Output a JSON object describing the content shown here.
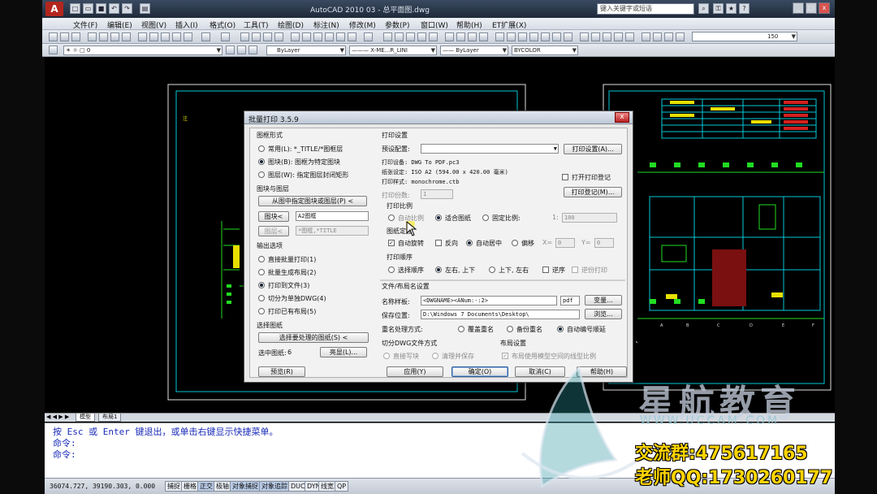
{
  "titlebar": {
    "app_logo": "A",
    "title": "AutoCAD 2010    03 - 总平面图.dwg",
    "search_placeholder": "键入关键字或短语"
  },
  "menu": [
    "文件(F)",
    "编辑(E)",
    "视图(V)",
    "插入(I)",
    "格式(O)",
    "工具(T)",
    "绘图(D)",
    "标注(N)",
    "修改(M)",
    "参数(P)",
    "窗口(W)",
    "帮助(H)",
    "ET扩展(X)"
  ],
  "toolbar": {
    "scale_value": "150",
    "layer_value": "0",
    "color_value": "ByLayer",
    "linetype_value": "X-ME...R_LINI",
    "lineweight_value": "ByLayer",
    "plotstyle_value": "BYCOLOR"
  },
  "tabs": {
    "model": "模型",
    "layout1": "布局1"
  },
  "command": {
    "line1": "按 Esc 或 Enter 键退出，或单击右键显示快捷菜单。",
    "line2": "命令:",
    "line3": "命令:"
  },
  "status": {
    "coords": "36074.727, 39190.303, 0.000",
    "buttons": [
      "捕捉",
      "栅格",
      "正交",
      "极轴",
      "对象捕捉",
      "对象追踪",
      "DUCS",
      "DYN",
      "线宽",
      "QP"
    ],
    "active": [
      2,
      4,
      5
    ]
  },
  "dialog": {
    "title": "批量打印 3.5.9",
    "close": "x",
    "frame": {
      "heading": "图框形式",
      "opt1": "常用(L): *_TITLE/*图框层",
      "opt2": "图块(B): 图框为特定图块",
      "opt3": "图层(W): 指定图层封闭矩形"
    },
    "block_layer": {
      "heading": "图块与图层",
      "pick_button": "从图中指定图块或图层(P) <",
      "block_button": "图块<",
      "block_value": "A2图框",
      "layer_button": "图层<",
      "layer_value": "*图框,*TITLE"
    },
    "output": {
      "heading": "输出选项",
      "opt1": "直接批量打印(1)",
      "opt2": "批量生成布局(2)",
      "opt3": "打印到文件(3)",
      "opt4": "切分为单独DWG(4)",
      "opt5": "打印已有布局(5)"
    },
    "select": {
      "heading": "选择图纸",
      "button": "选择要处理的图纸(S) <",
      "selected_label": "选中图纸:",
      "selected_count": "6",
      "highlight_button": "亮显(L)..."
    },
    "preview_button": "预览(R)",
    "print_settings": {
      "heading": "打印设置",
      "preset_label": "预设配置:",
      "preset_value": "",
      "setup_button": "打印设置(A)...",
      "device": "打印设备: DWG To PDF.pc3",
      "paper": "纸张设定: ISO A2 (594.00 x 420.00 毫米)",
      "style": "打印样式: monochrome.ctb",
      "open_log_label": "打开打印登记",
      "log_button": "打印登记(M)...",
      "copies_label": "打印份数:",
      "copies_value": "1"
    },
    "scale": {
      "heading": "打印比例",
      "auto": "自动比例",
      "fit": "适合图纸",
      "fixed": "固定比例:",
      "ratio_sep": "1:",
      "ratio_value": "100"
    },
    "placement": {
      "heading": "图纸定位",
      "auto_rotate": "自动旋转",
      "reverse": "反向",
      "auto_center": "自动居中",
      "offset": "偏移",
      "x_label": "X=",
      "x_value": "0",
      "y_label": "Y=",
      "y_value": "0"
    },
    "order": {
      "heading": "打印顺序",
      "by_select": "选择顺序",
      "lr_tb": "左右, 上下",
      "tb_lr": "上下, 左右",
      "reverse": "逆序",
      "reverse_print": "逆份打印"
    },
    "file_layout": {
      "heading": "文件/布局名设置",
      "template_label": "名称样板:",
      "template_value": "<DWGNAME><ANum:-:2>",
      "ext_value": "pdf",
      "var_button": "变量...",
      "save_label": "保存位置:",
      "save_value": "D:\\Windows 7 Documents\\Desktop\\",
      "browse_button": "浏览...",
      "dup_label": "重名处理方式:",
      "overwrite": "覆盖重名",
      "backup": "备份重名",
      "auto_number": "自动编号顺延"
    },
    "split": {
      "heading": "切分DWG文件方式",
      "write_block": "直接写块",
      "clean_save": "清理并保存"
    },
    "layout_set": {
      "heading": "布局设置",
      "use_model_lt": "布局使用模型空间的线型比例"
    },
    "buttons": {
      "apply": "应用(Y)",
      "ok": "确定(O)",
      "cancel": "取消(C)",
      "help": "帮助(H)"
    }
  },
  "watermark": {
    "name": "星航教育",
    "url": "WWW.UCCAM.COM",
    "group": "交流群:475617165",
    "qq": "老师QQ:1730260177"
  },
  "colors": {
    "drawing_bg": "#000000",
    "cad_cyan": "#00c8d8",
    "cad_green": "#22dd22",
    "cad_yellow": "#e8e000",
    "command_text": "#1a2bb8",
    "watermark_yellow": "#ffd400"
  }
}
